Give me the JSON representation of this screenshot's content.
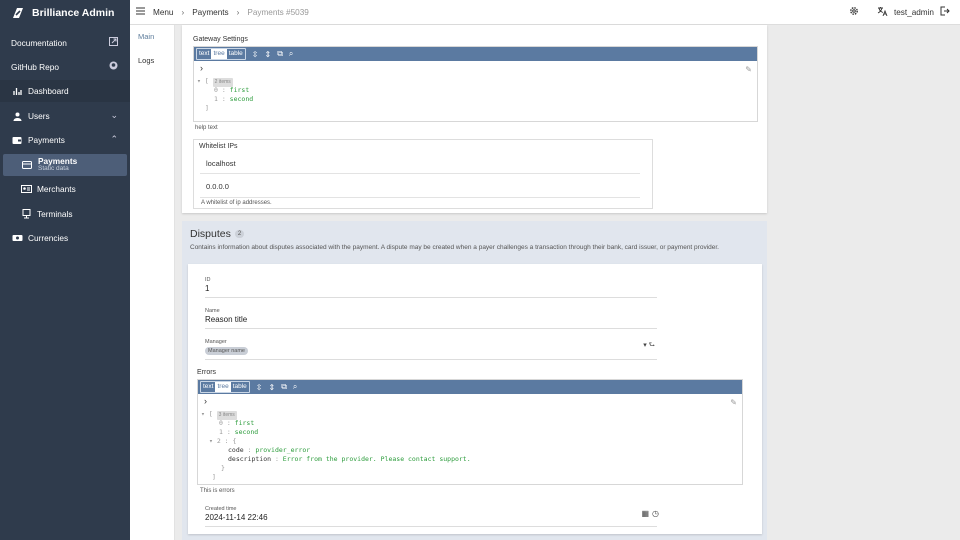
{
  "app": {
    "title": "Brilliance Admin"
  },
  "sidebar": {
    "items": [
      {
        "label": "Documentation",
        "icon": "external-link-icon"
      },
      {
        "label": "GitHub Repo",
        "icon": "github-icon"
      },
      {
        "label": "Dashboard",
        "icon": "dashboard-icon"
      },
      {
        "label": "Users",
        "icon": "user-icon"
      },
      {
        "label": "Payments",
        "icon": "wallet-icon"
      },
      {
        "label": "Payments",
        "sublabel": "Static data",
        "icon": "card-icon"
      },
      {
        "label": "Merchants",
        "icon": "id-card-icon"
      },
      {
        "label": "Terminals",
        "icon": "terminal-icon"
      },
      {
        "label": "Currencies",
        "icon": "cash-icon"
      }
    ]
  },
  "topbar": {
    "crumbs": [
      "Menu",
      "Payments",
      "Payments #5039"
    ],
    "user": "test_admin"
  },
  "tabs": [
    "Main",
    "Logs"
  ],
  "gateway": {
    "label": "Gateway Settings",
    "modes": [
      "text",
      "tree",
      "table"
    ],
    "count": "2 items",
    "lines": [
      {
        "k": "0",
        "v": "first"
      },
      {
        "k": "1",
        "v": "second"
      }
    ],
    "help": "help text"
  },
  "whitelist": {
    "label": "Whitelist IPs",
    "values": [
      "localhost",
      "0.0.0.0"
    ],
    "help": "A whitelist of ip addresses."
  },
  "disputes": {
    "title": "Disputes",
    "count": "2",
    "desc": "Contains information about disputes associated with the payment. A dispute may be created when a payer challenges a transaction through their bank, card issuer, or payment provider.",
    "id_label": "ID",
    "id_value": "1",
    "name_label": "Name",
    "name_value": "Reason title",
    "manager_label": "Manager",
    "manager_value": "Manager name",
    "errors_label": "Errors",
    "errors_count": "3 items",
    "errors_lines": [
      {
        "k": "0",
        "v": "first"
      },
      {
        "k": "1",
        "v": "second"
      },
      {
        "k": "2",
        "v": "{"
      },
      {
        "k": "code",
        "v": "provider_error"
      },
      {
        "k": "description",
        "v": "Error from the provider. Please contact support."
      },
      {
        "k": "",
        "v": "}"
      }
    ],
    "errors_help": "This is errors",
    "created_label": "Created time",
    "created_value": "2024-11-14 22:46"
  }
}
